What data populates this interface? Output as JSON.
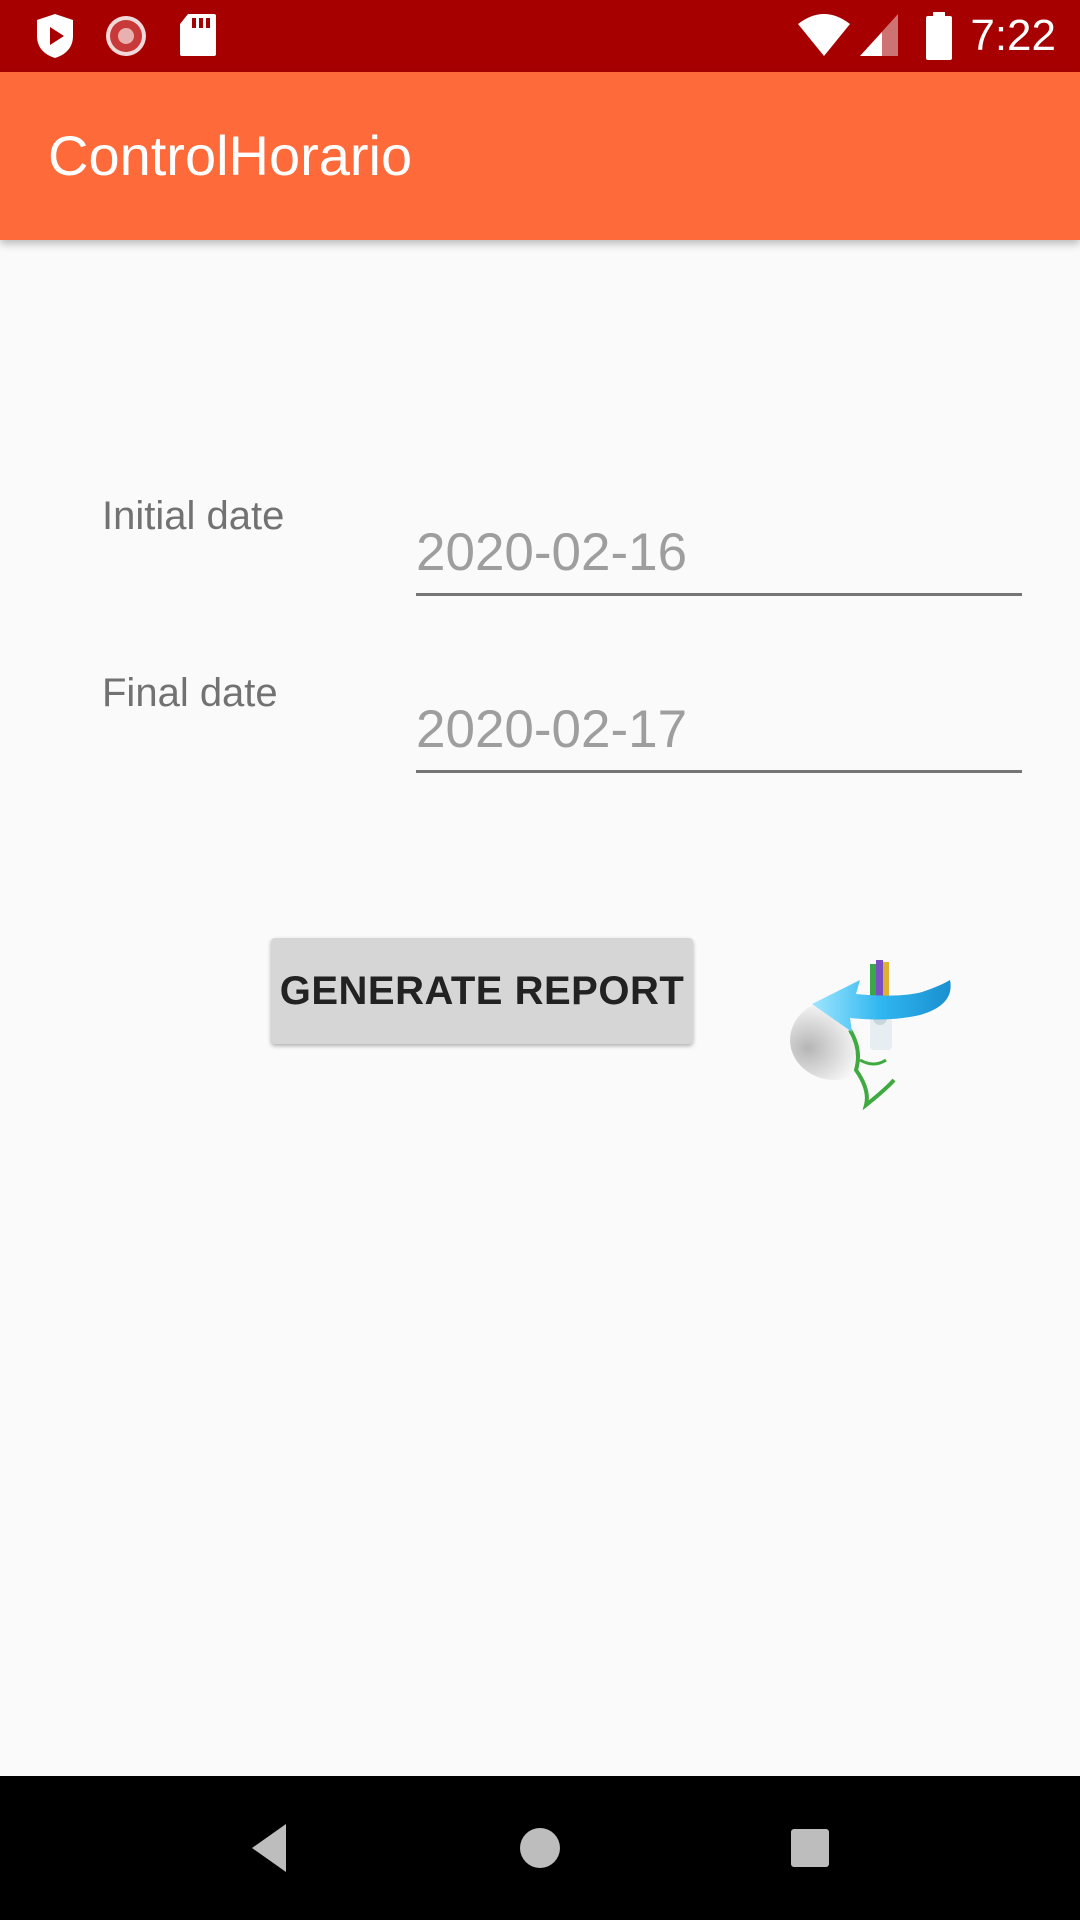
{
  "status_bar": {
    "time": "7:22",
    "icons": [
      "play-shield-icon",
      "loading-spinner-icon",
      "sd-card-icon",
      "wifi-icon",
      "cell-signal-icon",
      "battery-icon"
    ]
  },
  "app_bar": {
    "title": "ControlHorario"
  },
  "form": {
    "initial_label": "Initial date",
    "initial_value": "2020-02-16",
    "final_label": "Final date",
    "final_value": "2020-02-17"
  },
  "actions": {
    "generate_label": "GENERATE REPORT",
    "logo_icon": "back-arrow-logo-icon"
  },
  "nav_bar": {
    "buttons": [
      "back-icon",
      "home-icon",
      "recents-icon"
    ]
  },
  "colors": {
    "status_bar": "#a60000",
    "app_bar": "#ff6a3a",
    "background": "#fafafa",
    "button": "#d6d6d6",
    "nav_bar": "#000000"
  }
}
